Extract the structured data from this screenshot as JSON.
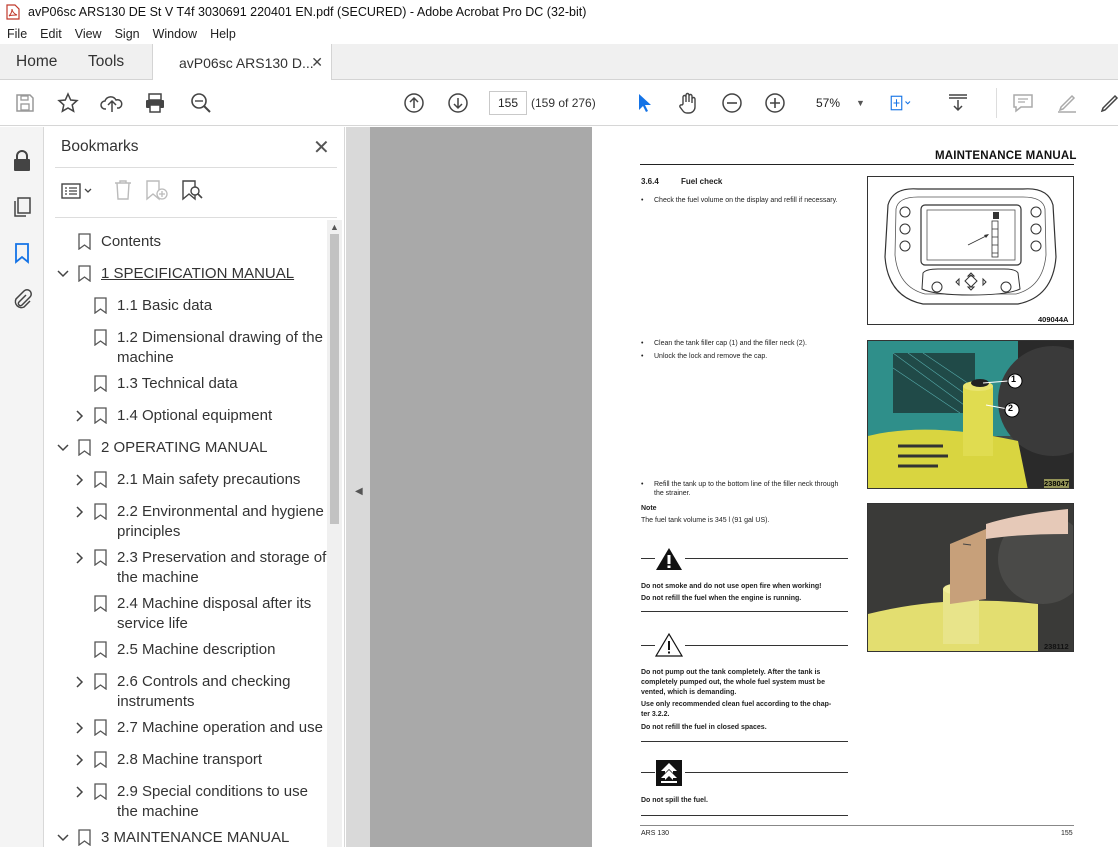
{
  "window": {
    "title": "avP06sc ARS130 DE St V T4f 3030691 220401 EN.pdf (SECURED) - Adobe Acrobat Pro DC (32-bit)"
  },
  "menu": [
    "File",
    "Edit",
    "View",
    "Sign",
    "Window",
    "Help"
  ],
  "tabs": {
    "home": "Home",
    "tools": "Tools",
    "doc": "avP06sc ARS130 D..."
  },
  "toolbar": {
    "page_value": "155",
    "page_count": "(159 of 276)",
    "zoom": "57%"
  },
  "bookmarks": {
    "title": "Bookmarks",
    "items": [
      {
        "label": "Contents"
      },
      {
        "label": "1 SPECIFICATION MANUAL"
      },
      {
        "label": "1.1 Basic data"
      },
      {
        "label": "1.2 Dimensional drawing of the machine"
      },
      {
        "label": "1.3 Technical data"
      },
      {
        "label": "1.4 Optional equipment"
      },
      {
        "label": "2 OPERATING MANUAL"
      },
      {
        "label": "2.1 Main safety precautions"
      },
      {
        "label": "2.2 Environmental and hygiene principles"
      },
      {
        "label": "2.3 Preservation and storage of the machine"
      },
      {
        "label": "2.4 Machine disposal after its service life"
      },
      {
        "label": "2.5 Machine description"
      },
      {
        "label": "2.6 Controls and checking instruments"
      },
      {
        "label": "2.7 Machine operation and use"
      },
      {
        "label": "2.8 Machine transport"
      },
      {
        "label": "2.9 Special conditions to use the machine"
      },
      {
        "label": "3 MAINTENANCE MANUAL"
      }
    ]
  },
  "doc": {
    "header": "MAINTENANCE MANUAL",
    "section_no": "3.6.4",
    "section_title": "Fuel check",
    "b1": "Check the fuel volume on the display and refill if necessary.",
    "b2": "Clean the tank filler cap (1) and the filler neck (2).",
    "b3": "Unlock the lock and remove the cap.",
    "b4a": "Refill the tank up to the bottom line of the filler neck through",
    "b4b": "the strainer.",
    "note_title": "Note",
    "note_text": "The fuel tank volume is 345 l (91 gal US).",
    "w1a": "Do not smoke and do not use open fire when working!",
    "w1b": "Do not refill the fuel when the engine is running.",
    "w2a": "Do not pump out the tank completely. After the tank is",
    "w2b": "completely pumped out, the whole fuel system must be",
    "w2c": "vented, which is demanding.",
    "w2d": "Use only recommended clean fuel according to the chap-",
    "w2e": "ter 3.2.2.",
    "w2f": "Do not refill the fuel in closed spaces.",
    "w3": "Do not spill the fuel.",
    "fig1": "409044A",
    "fig2": "238047",
    "fig3": "238112",
    "callout1": "1",
    "callout2": "2",
    "footer_left": "ARS 130",
    "footer_right": "155"
  }
}
